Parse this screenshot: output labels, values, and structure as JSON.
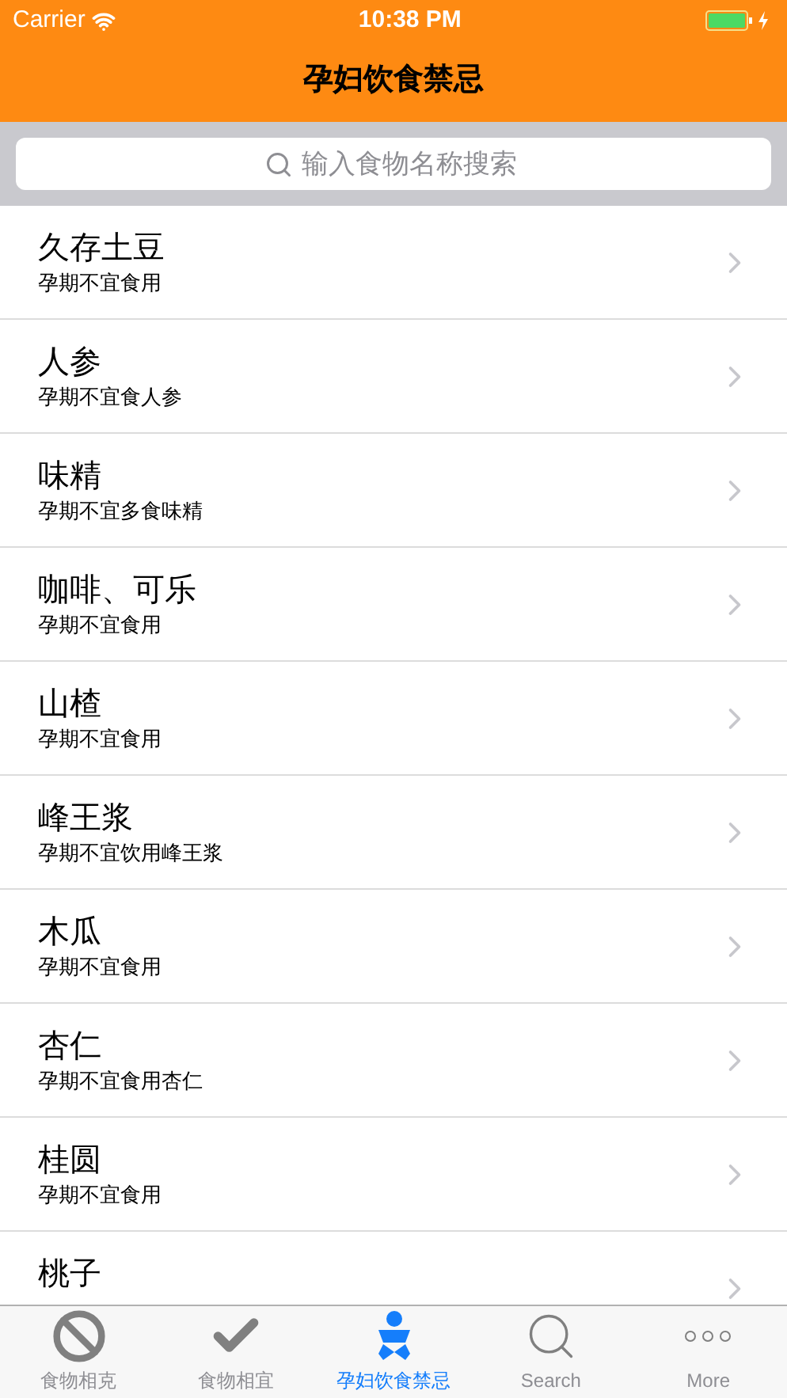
{
  "status_bar": {
    "carrier": "Carrier",
    "time": "10:38 PM"
  },
  "nav": {
    "title": "孕妇饮食禁忌"
  },
  "search": {
    "placeholder": "输入食物名称搜索"
  },
  "items": [
    {
      "title": "久存土豆",
      "subtitle": "孕期不宜食用"
    },
    {
      "title": "人参",
      "subtitle": "孕期不宜食人参"
    },
    {
      "title": "味精",
      "subtitle": "孕期不宜多食味精"
    },
    {
      "title": "咖啡、可乐",
      "subtitle": "孕期不宜食用"
    },
    {
      "title": "山楂",
      "subtitle": "孕期不宜食用"
    },
    {
      "title": "峰王浆",
      "subtitle": "孕期不宜饮用峰王浆"
    },
    {
      "title": "木瓜",
      "subtitle": "孕期不宜食用"
    },
    {
      "title": "杏仁",
      "subtitle": "孕期不宜食用杏仁"
    },
    {
      "title": "桂圆",
      "subtitle": "孕期不宜食用"
    },
    {
      "title": "桃子"
    }
  ],
  "tabs": [
    {
      "kind": "ban",
      "label": "食物相克",
      "selected": false
    },
    {
      "kind": "check",
      "label": "食物相宜",
      "selected": false
    },
    {
      "kind": "baby",
      "label": "孕妇饮食禁忌",
      "selected": true
    },
    {
      "kind": "search",
      "label": "Search",
      "selected": false
    },
    {
      "kind": "more",
      "label": "More",
      "selected": false
    }
  ]
}
